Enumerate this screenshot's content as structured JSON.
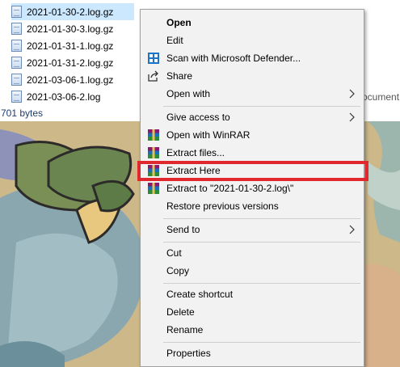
{
  "files": [
    {
      "name": "2021-01-30-2.log.gz",
      "selected": true
    },
    {
      "name": "2021-01-30-3.log.gz"
    },
    {
      "name": "2021-01-31-1.log.gz"
    },
    {
      "name": "2021-01-31-2.log.gz"
    },
    {
      "name": "2021-03-06-1.log.gz"
    },
    {
      "name": "2021-03-06-2.log",
      "partial_type": "ocument"
    }
  ],
  "status": {
    "text": "701 bytes"
  },
  "menu": {
    "items": [
      {
        "label": "Open"
      },
      {
        "label": "Edit"
      },
      {
        "label": "Scan with Microsoft Defender..."
      },
      {
        "label": "Share"
      },
      {
        "label": "Open with"
      },
      {
        "label": "Give access to"
      },
      {
        "label": "Open with WinRAR"
      },
      {
        "label": "Extract files..."
      },
      {
        "label": "Extract Here"
      },
      {
        "label": "Extract to \"2021-01-30-2.log\\\""
      },
      {
        "label": "Restore previous versions"
      },
      {
        "label": "Send to"
      },
      {
        "label": "Cut"
      },
      {
        "label": "Copy"
      },
      {
        "label": "Create shortcut"
      },
      {
        "label": "Delete"
      },
      {
        "label": "Rename"
      },
      {
        "label": "Properties"
      }
    ]
  },
  "colors": {
    "highlight": "#e0282e",
    "selection": "#cce8ff",
    "menu_bg": "#f2f2f2"
  }
}
